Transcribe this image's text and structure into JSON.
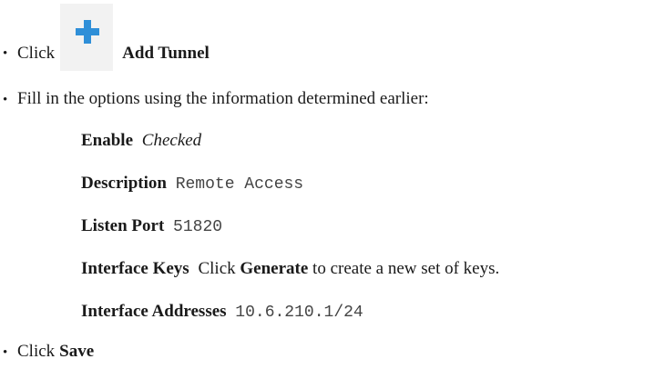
{
  "steps": {
    "click1": {
      "prefix": "Click",
      "icon": "plus-icon",
      "label": "Add Tunnel"
    },
    "fill": {
      "text": "Fill in the options using the information determined earlier:"
    },
    "fields": {
      "enable": {
        "label": "Enable",
        "value": "Checked"
      },
      "description": {
        "label": "Description",
        "value": "Remote Access"
      },
      "listen_port": {
        "label": "Listen Port",
        "value": "51820"
      },
      "interface_keys": {
        "label": "Interface Keys",
        "pre": "Click",
        "action": "Generate",
        "post": "to create a new set of keys."
      },
      "interface_addresses": {
        "label": "Interface Addresses",
        "value": "10.6.210.1/24"
      }
    },
    "click2": {
      "prefix": "Click",
      "action": "Save"
    }
  },
  "colors": {
    "accent": "#2f8fd8",
    "icon_bg": "#f2f2f2",
    "mono_text": "#444444"
  }
}
